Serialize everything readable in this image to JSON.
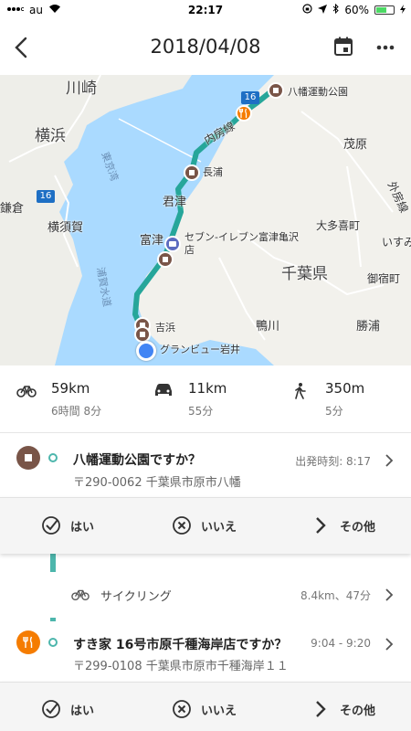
{
  "status_bar": {
    "carrier": "au",
    "time": "22:17",
    "battery": "60%",
    "battery_level": 0.6
  },
  "header": {
    "title": "2018/04/08"
  },
  "map": {
    "labels": {
      "kawasaki": "川崎",
      "yokohama": "横浜",
      "yokosuka": "横須賀",
      "kamakura": "鎌倉",
      "tokyo_bay": "東京湾",
      "uraga": "浦賀水道",
      "uchibo": "内房線",
      "yawata_park": "八幡運動公園",
      "nagaura": "長浦",
      "kisarazu": "君津",
      "futtsu": "富津",
      "seven": "セブン-イレブン富津亀沢\n店",
      "yoshihama": "吉浜",
      "granview": "グランビュー岩井",
      "chiba_ken": "千葉県",
      "mobara": "茂原",
      "otaki": "大多喜町",
      "sotobo": "外房線",
      "isumi": "いすみ",
      "onjuku": "御宿町",
      "katsuura": "勝浦",
      "kamogawa": "鴨川",
      "route_16a": "16",
      "route_16b": "16"
    }
  },
  "stats": [
    {
      "icon": "bicycle-icon",
      "value": "59km",
      "sub": "6時間 8分"
    },
    {
      "icon": "car-icon",
      "value": "11km",
      "sub": "55分"
    },
    {
      "icon": "walking-icon",
      "value": "350m",
      "sub": "5分"
    }
  ],
  "timeline": {
    "place1": {
      "name": "八幡運動公園ですか？",
      "address": "〒290-0062 千葉県市原市八幡",
      "time": "出発時刻: 8:17",
      "pin_color": "#795548"
    },
    "answers1": {
      "yes": "はい",
      "no": "いいえ",
      "other": "その他"
    },
    "activity": {
      "label": "サイクリング",
      "meta": "8.4km、47分"
    },
    "place2": {
      "name": "すき家 16号市原千種海岸店ですか？",
      "address": "〒299-0108 千葉県市原市千種海岸１１",
      "time": "9:04 - 9:20",
      "pin_color": "#f57c00"
    },
    "answers2": {
      "yes": "はい",
      "no": "いいえ",
      "other": "その他"
    }
  },
  "colors": {
    "route": "#26a69a",
    "timeline": "#4db6ac",
    "sea": "#aadaff",
    "land": "#f2f1ec",
    "current_location": "#4285f4"
  }
}
